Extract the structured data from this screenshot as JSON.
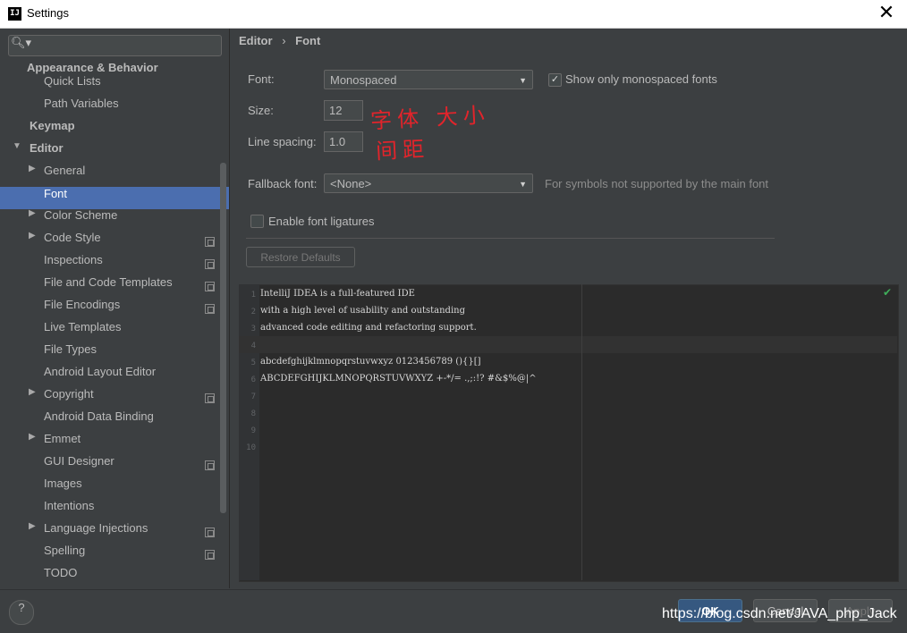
{
  "window": {
    "title": "Settings",
    "app_icon_text": "IJ",
    "close_glyph": "✕"
  },
  "search": {
    "icon": "🔍︎▾",
    "placeholder": ""
  },
  "sidebar": {
    "items": [
      {
        "label": "Appearance & Behavior",
        "bold": true
      },
      {
        "label": "Quick Lists"
      },
      {
        "label": "Path Variables"
      },
      {
        "label": "Keymap",
        "bold": true
      },
      {
        "label": "Editor",
        "bold": true,
        "expanded": true
      },
      {
        "label": "General"
      },
      {
        "label": "Font",
        "selected": true
      },
      {
        "label": "Color Scheme"
      },
      {
        "label": "Code Style"
      },
      {
        "label": "Inspections"
      },
      {
        "label": "File and Code Templates"
      },
      {
        "label": "File Encodings"
      },
      {
        "label": "Live Templates"
      },
      {
        "label": "File Types"
      },
      {
        "label": "Android Layout Editor"
      },
      {
        "label": "Copyright"
      },
      {
        "label": "Android Data Binding"
      },
      {
        "label": "Emmet"
      },
      {
        "label": "GUI Designer"
      },
      {
        "label": "Images"
      },
      {
        "label": "Intentions"
      },
      {
        "label": "Language Injections"
      },
      {
        "label": "Spelling"
      },
      {
        "label": "TODO"
      }
    ]
  },
  "breadcrumb": {
    "part1": "Editor",
    "sep": "›",
    "part2": "Font"
  },
  "form": {
    "font_label": "Font:",
    "font_value": "Monospaced",
    "show_mono_label": "Show only monospaced fonts",
    "size_label": "Size:",
    "size_value": "12",
    "line_spacing_label": "Line spacing:",
    "line_spacing_value": "1.0",
    "fallback_label": "Fallback font:",
    "fallback_value": "<None>",
    "fallback_hint": "For symbols not supported by the main font",
    "ligatures_label": "Enable font ligatures",
    "restore_label": "Restore Defaults"
  },
  "annotations": {
    "line1": "字体 大小",
    "line2": "间距"
  },
  "preview": {
    "line_numbers": [
      "1",
      "2",
      "3",
      "4",
      "5",
      "6",
      "7",
      "8",
      "9",
      "10"
    ],
    "lines": [
      "IntelliJ IDEA is a full-featured IDE",
      "with a high level of usability and outstanding",
      "advanced code editing and refactoring support.",
      "",
      "abcdefghijklmnopqrstuvwxyz 0123456789 (){}[]",
      "ABCDEFGHIJKLMNOPQRSTUVWXYZ +-*/= .,;:!? #&$%@|^"
    ]
  },
  "footer": {
    "help": "?",
    "ok": "OK",
    "cancel": "Cancel",
    "apply": "Apply",
    "watermark": "https://blog.csdn.net/JAVA_php_Jack"
  },
  "colors": {
    "selection": "#4b6eaf",
    "ok_button": "#365880",
    "annotation": "#e2242b"
  }
}
